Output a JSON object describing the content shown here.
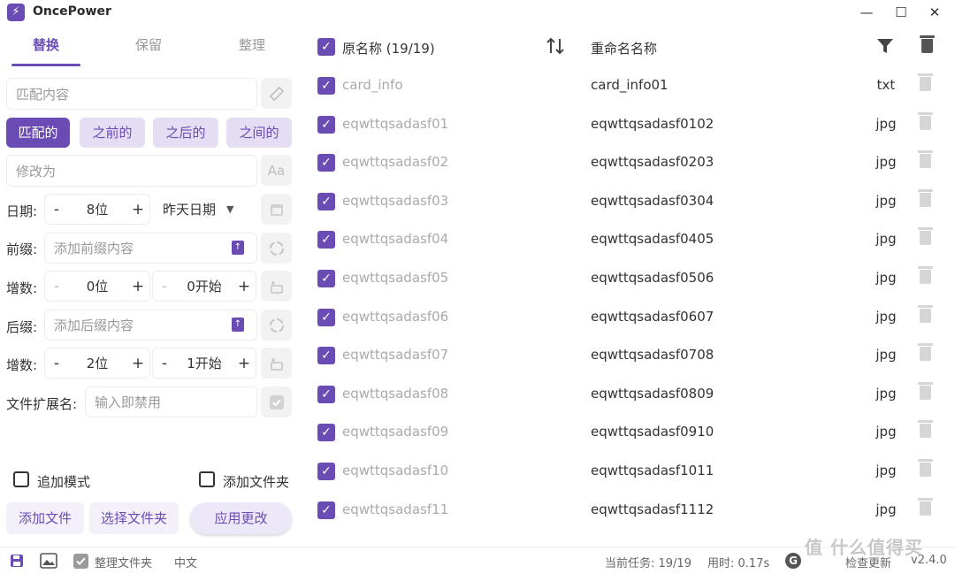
{
  "app": {
    "title": "OncePower",
    "logo_glyph": "⚡",
    "accent_color": "#6a4cb4"
  },
  "window_controls": {
    "minimize": "—",
    "maximize": "☐",
    "close": "✕"
  },
  "tabs": [
    {
      "label": "替换",
      "active": true
    },
    {
      "label": "保留",
      "active": false
    },
    {
      "label": "整理",
      "active": false
    }
  ],
  "replace": {
    "match_placeholder": "匹配内容",
    "modes": [
      "匹配的",
      "之前的",
      "之后的",
      "之间的"
    ],
    "replace_placeholder": "修改为"
  },
  "date_row": {
    "label": "日期:",
    "minus": "-",
    "value": "8位",
    "plus": "+",
    "option": "昨天日期"
  },
  "prefix": {
    "label": "前缀:",
    "placeholder": "添加前缀内容"
  },
  "prefix_increment": {
    "label": "增数:",
    "digits": "0位",
    "start": "0开始",
    "minus": "-",
    "plus": "+"
  },
  "suffix": {
    "label": "后缀:",
    "placeholder": "添加后缀内容"
  },
  "suffix_increment": {
    "label": "增数:",
    "digits": "2位",
    "start": "1开始",
    "minus": "-",
    "plus": "+"
  },
  "extension": {
    "label": "文件扩展名:",
    "placeholder": "输入即禁用"
  },
  "options": {
    "append_mode": "追加模式",
    "add_folder": "添加文件夹"
  },
  "actions": {
    "add_files": "添加文件",
    "choose_folder": "选择文件夹",
    "apply": "应用更改"
  },
  "list": {
    "header_original": "原名称 (19/19)",
    "header_renamed": "重命名名称",
    "rows": [
      {
        "original": "card_info",
        "renamed": "card_info01",
        "ext": "txt"
      },
      {
        "original": "eqwttqsadasf01",
        "renamed": "eqwttqsadasf0102",
        "ext": "jpg"
      },
      {
        "original": "eqwttqsadasf02",
        "renamed": "eqwttqsadasf0203",
        "ext": "jpg"
      },
      {
        "original": "eqwttqsadasf03",
        "renamed": "eqwttqsadasf0304",
        "ext": "jpg"
      },
      {
        "original": "eqwttqsadasf04",
        "renamed": "eqwttqsadasf0405",
        "ext": "jpg"
      },
      {
        "original": "eqwttqsadasf05",
        "renamed": "eqwttqsadasf0506",
        "ext": "jpg"
      },
      {
        "original": "eqwttqsadasf06",
        "renamed": "eqwttqsadasf0607",
        "ext": "jpg"
      },
      {
        "original": "eqwttqsadasf07",
        "renamed": "eqwttqsadasf0708",
        "ext": "jpg"
      },
      {
        "original": "eqwttqsadasf08",
        "renamed": "eqwttqsadasf0809",
        "ext": "jpg"
      },
      {
        "original": "eqwttqsadasf09",
        "renamed": "eqwttqsadasf0910",
        "ext": "jpg"
      },
      {
        "original": "eqwttqsadasf10",
        "renamed": "eqwttqsadasf1011",
        "ext": "jpg"
      },
      {
        "original": "eqwttqsadasf11",
        "renamed": "eqwttqsadasf1112",
        "ext": "jpg"
      }
    ]
  },
  "footer": {
    "organize_folder": "整理文件夹",
    "language": "中文",
    "task": "当前任务: 19/19",
    "elapsed": "用时: 0.17s",
    "update": "检查更新",
    "version": "v2.4.0",
    "watermark": "值 什么值得买"
  }
}
